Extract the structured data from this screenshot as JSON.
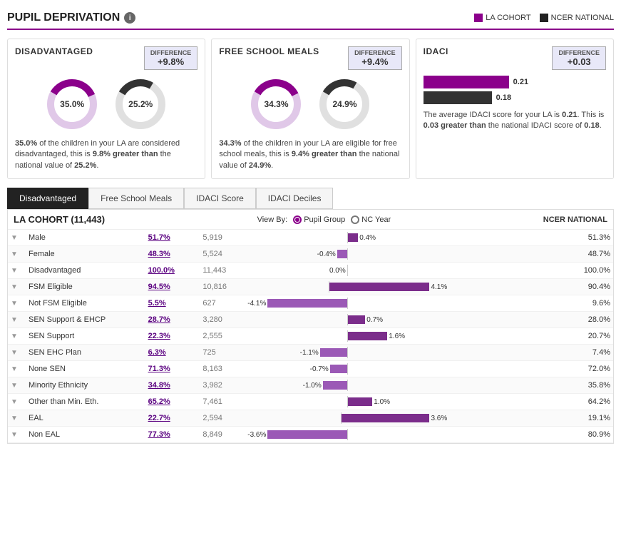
{
  "header": {
    "title": "PUPIL DEPRIVATION",
    "legend": {
      "la_cohort": "LA COHORT",
      "ncer_national": "NCER NATIONAL",
      "la_color": "#8B008B",
      "ncer_color": "#222222"
    }
  },
  "cards": [
    {
      "id": "disadvantaged",
      "title": "DISADVANTAGED",
      "diff_label": "DIFFERENCE",
      "diff_value": "+9.8%",
      "la_pct": "35.0%",
      "ncer_pct": "25.2%",
      "la_value": 35.0,
      "ncer_value": 25.2,
      "description_html": "35.0% of the children in your LA are considered disadvantaged, this is 9.8% greater than the national value of 25.2%."
    },
    {
      "id": "free_school_meals",
      "title": "FREE SCHOOL MEALS",
      "diff_label": "DIFFERENCE",
      "diff_value": "+9.4%",
      "la_pct": "34.3%",
      "ncer_pct": "24.9%",
      "la_value": 34.3,
      "ncer_value": 24.9,
      "description_html": "34.3% of the children in your LA are eligible for free school meals, this is 9.4% greater than the national value of 24.9%."
    },
    {
      "id": "idaci",
      "title": "IDACI",
      "diff_label": "DIFFERENCE",
      "diff_value": "+0.03",
      "la_score": "0.21",
      "ncer_score": "0.18",
      "la_bar_pct": 70,
      "ncer_bar_pct": 55,
      "description_html": "The average IDACI score for your LA is 0.21. This is 0.03 greater than the national IDACI score of 0.18."
    }
  ],
  "tabs": [
    {
      "id": "disadvantaged",
      "label": "Disadvantaged",
      "active": true
    },
    {
      "id": "free-school-meals",
      "label": "Free School Meals",
      "active": false
    },
    {
      "id": "idaci-score",
      "label": "IDACI Score",
      "active": false
    },
    {
      "id": "idaci-deciles",
      "label": "IDACI Deciles",
      "active": false
    }
  ],
  "table": {
    "cohort_label": "LA COHORT (11,443)",
    "view_by_label": "View By:",
    "pupil_group_label": "Pupil Group",
    "nc_year_label": "NC Year",
    "ncer_label": "NCER NATIONAL",
    "rows": [
      {
        "label": "Male",
        "pct": "51.7%",
        "count": "5,919",
        "diff": 0.4,
        "diff_label": "0.4%",
        "ncer": "51.3%",
        "positive": true
      },
      {
        "label": "Female",
        "pct": "48.3%",
        "count": "5,524",
        "diff": -0.4,
        "diff_label": "-0.4%",
        "ncer": "48.7%",
        "positive": false
      },
      {
        "label": "Disadvantaged",
        "pct": "100.0%",
        "count": "11,443",
        "diff": 0.0,
        "diff_label": "0.0%",
        "ncer": "100.0%",
        "positive": true
      },
      {
        "label": "FSM Eligible",
        "pct": "94.5%",
        "count": "10,816",
        "diff": 4.1,
        "diff_label": "4.1%",
        "ncer": "90.4%",
        "positive": true
      },
      {
        "label": "Not FSM Eligible",
        "pct": "5.5%",
        "count": "627",
        "diff": -4.1,
        "diff_label": "-4.1%",
        "ncer": "9.6%",
        "positive": false
      },
      {
        "label": "SEN Support & EHCP",
        "pct": "28.7%",
        "count": "3,280",
        "diff": 0.7,
        "diff_label": "0.7%",
        "ncer": "28.0%",
        "positive": true
      },
      {
        "label": "SEN Support",
        "pct": "22.3%",
        "count": "2,555",
        "diff": 1.6,
        "diff_label": "1.6%",
        "ncer": "20.7%",
        "positive": true
      },
      {
        "label": "SEN EHC Plan",
        "pct": "6.3%",
        "count": "725",
        "diff": -1.1,
        "diff_label": "-1.1%",
        "ncer": "7.4%",
        "positive": false
      },
      {
        "label": "None SEN",
        "pct": "71.3%",
        "count": "8,163",
        "diff": -0.7,
        "diff_label": "-0.7%",
        "ncer": "72.0%",
        "positive": false
      },
      {
        "label": "Minority Ethnicity",
        "pct": "34.8%",
        "count": "3,982",
        "diff": -1.0,
        "diff_label": "-1.0%",
        "ncer": "35.8%",
        "positive": false
      },
      {
        "label": "Other than Min. Eth.",
        "pct": "65.2%",
        "count": "7,461",
        "diff": 1.0,
        "diff_label": "1.0%",
        "ncer": "64.2%",
        "positive": true
      },
      {
        "label": "EAL",
        "pct": "22.7%",
        "count": "2,594",
        "diff": 3.6,
        "diff_label": "3.6%",
        "ncer": "19.1%",
        "positive": true
      },
      {
        "label": "Non EAL",
        "pct": "77.3%",
        "count": "8,849",
        "diff": -3.6,
        "diff_label": "-3.6%",
        "ncer": "80.9%",
        "positive": false
      }
    ]
  }
}
